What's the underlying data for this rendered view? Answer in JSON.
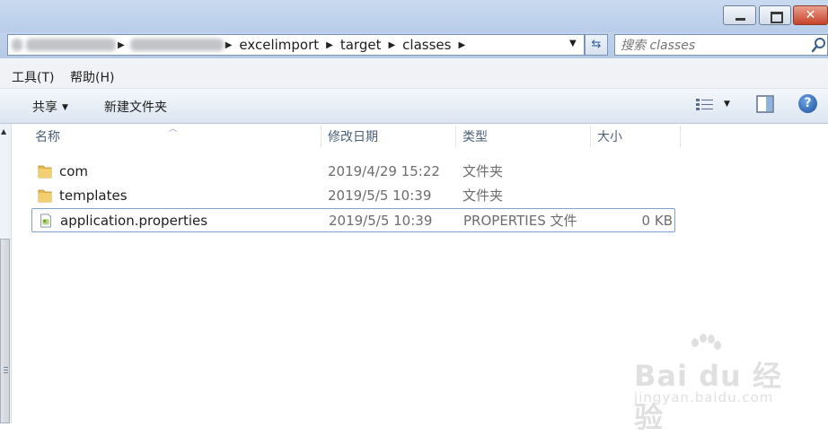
{
  "window": {
    "close_glyph": "✕"
  },
  "address": {
    "crumbs": [
      "excelimport",
      "target",
      "classes"
    ],
    "separator": "▶",
    "dropdown_glyph": "▼",
    "refresh_glyph": "⇆"
  },
  "search": {
    "placeholder": "搜索 classes"
  },
  "menu": {
    "tools": "工具(T)",
    "help": "帮助(H)"
  },
  "toolbar": {
    "share": "共享",
    "share_caret": "▼",
    "new_folder": "新建文件夹",
    "view_caret": "▼",
    "help_glyph": "?"
  },
  "columns": {
    "name": "名称",
    "date": "修改日期",
    "type": "类型",
    "size": "大小",
    "sort_glyph": "︿"
  },
  "files": [
    {
      "name": "com",
      "date": "2019/4/29 15:22",
      "type": "文件夹",
      "size": "",
      "icon": "folder-icon"
    },
    {
      "name": "templates",
      "date": "2019/5/5 10:39",
      "type": "文件夹",
      "size": "",
      "icon": "folder-icon"
    },
    {
      "name": "application.properties",
      "date": "2019/5/5 10:39",
      "type": "PROPERTIES 文件",
      "size": "0 KB",
      "icon": "properties-file-icon"
    }
  ],
  "watermark": {
    "logo": "Bai du 经验",
    "url": "jingyan.baidu.com"
  },
  "colors": {
    "titlebar": "#c9daf0",
    "accent": "#1e4f9c",
    "folder": "#e8b94a"
  }
}
